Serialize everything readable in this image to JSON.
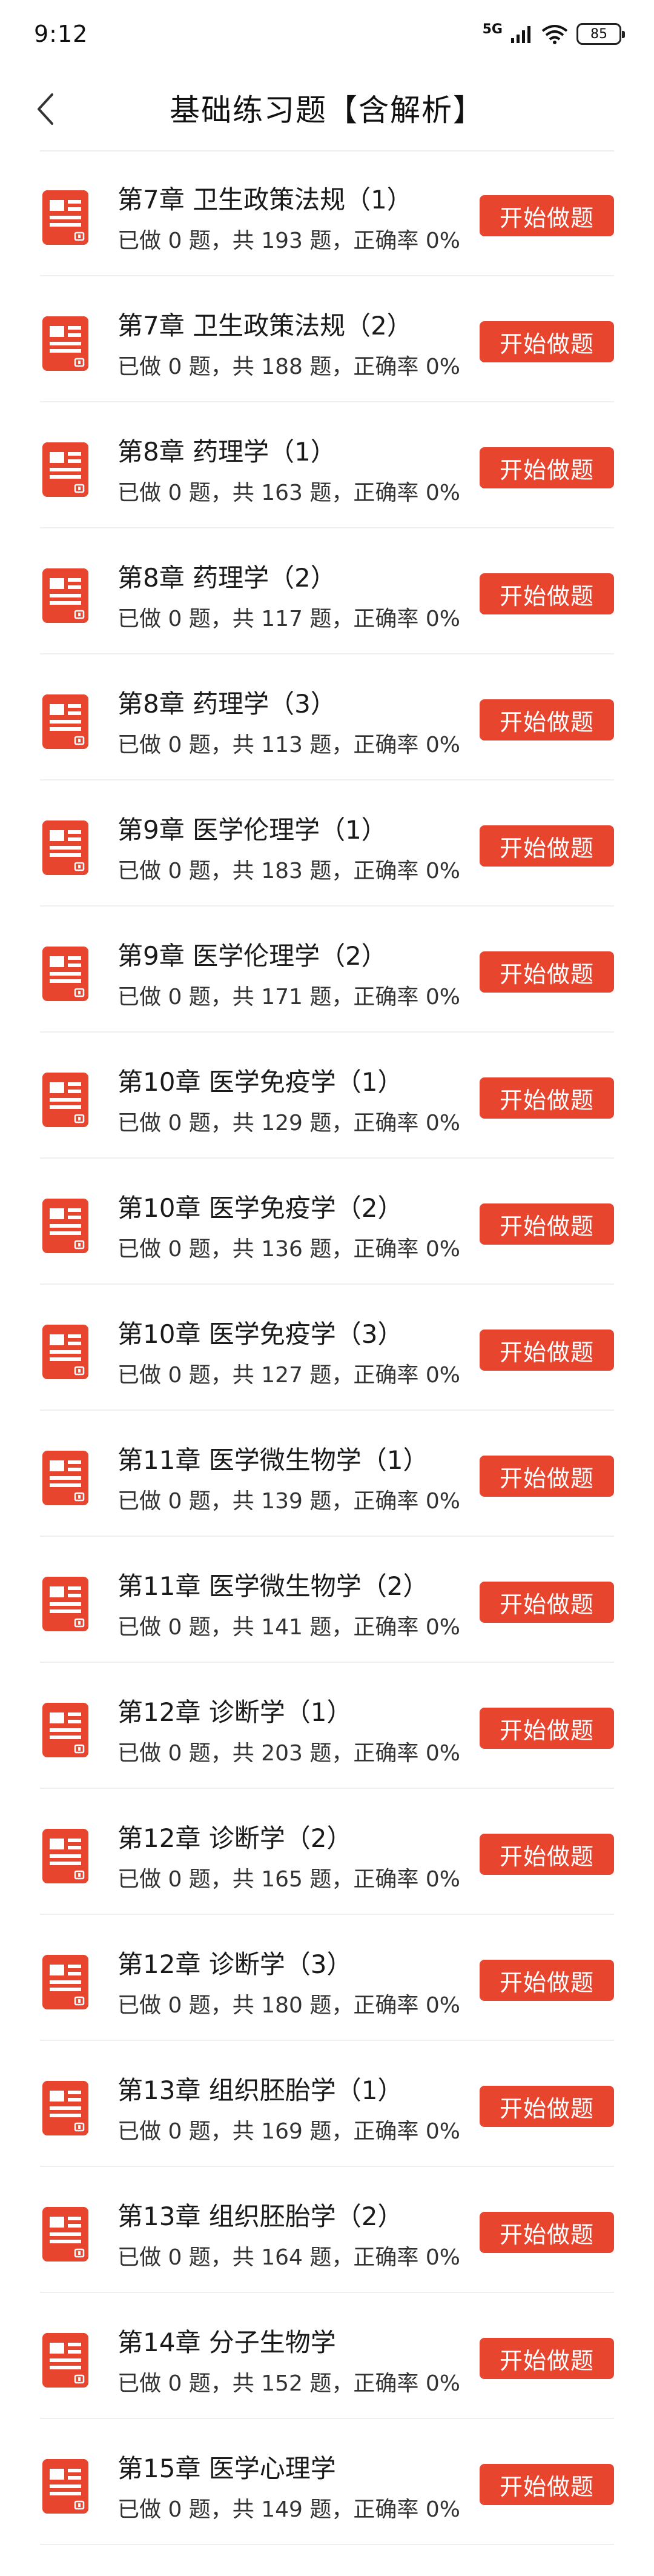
{
  "status_bar": {
    "time": "9:12",
    "network": "5G",
    "battery": "85"
  },
  "header": {
    "title": "基础练习题【含解析】"
  },
  "start_button_label": "开始做题",
  "items": [
    {
      "title": "第7章 卫生政策法规（1）",
      "stats": "已做 0 题，共 193 题，正确率 0%"
    },
    {
      "title": "第7章 卫生政策法规（2）",
      "stats": "已做 0 题，共 188 题，正确率 0%"
    },
    {
      "title": "第8章 药理学（1）",
      "stats": "已做 0 题，共 163 题，正确率 0%"
    },
    {
      "title": "第8章 药理学（2）",
      "stats": "已做 0 题，共 117 题，正确率 0%"
    },
    {
      "title": "第8章 药理学（3）",
      "stats": "已做 0 题，共 113 题，正确率 0%"
    },
    {
      "title": "第9章 医学伦理学（1）",
      "stats": "已做 0 题，共 183 题，正确率 0%"
    },
    {
      "title": "第9章 医学伦理学（2）",
      "stats": "已做 0 题，共 171 题，正确率 0%"
    },
    {
      "title": "第10章 医学免疫学（1）",
      "stats": "已做 0 题，共 129 题，正确率 0%"
    },
    {
      "title": "第10章 医学免疫学（2）",
      "stats": "已做 0 题，共 136 题，正确率 0%"
    },
    {
      "title": "第10章 医学免疫学（3）",
      "stats": "已做 0 题，共 127 题，正确率 0%"
    },
    {
      "title": "第11章 医学微生物学（1）",
      "stats": "已做 0 题，共 139 题，正确率 0%"
    },
    {
      "title": "第11章 医学微生物学（2）",
      "stats": "已做 0 题，共 141 题，正确率 0%"
    },
    {
      "title": "第12章 诊断学（1）",
      "stats": "已做 0 题，共 203 题，正确率 0%"
    },
    {
      "title": "第12章 诊断学（2）",
      "stats": "已做 0 题，共 165 题，正确率 0%"
    },
    {
      "title": "第12章 诊断学（3）",
      "stats": "已做 0 题，共 180 题，正确率 0%"
    },
    {
      "title": "第13章 组织胚胎学（1）",
      "stats": "已做 0 题，共 169 题，正确率 0%"
    },
    {
      "title": "第13章 组织胚胎学（2）",
      "stats": "已做 0 题，共 164 题，正确率 0%"
    },
    {
      "title": "第14章 分子生物学",
      "stats": "已做 0 题，共 152 题，正确率 0%"
    },
    {
      "title": "第15章 医学心理学",
      "stats": "已做 0 题，共 149 题，正确率 0%"
    }
  ],
  "colors": {
    "accent": "#e8452f",
    "icon": "#e8452f"
  },
  "icons": {
    "back": "chevron-left-icon",
    "item": "document-icon"
  }
}
